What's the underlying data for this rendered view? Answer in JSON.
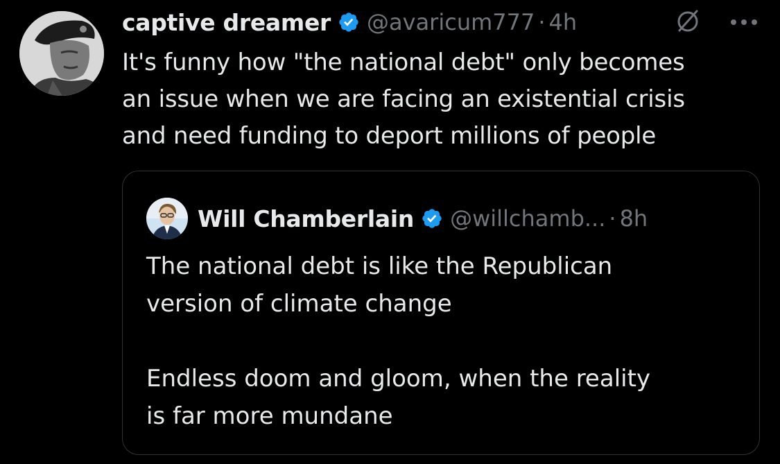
{
  "tweet": {
    "display_name": "captive dreamer",
    "handle": "@avaricum777",
    "separator": "·",
    "time": "4h",
    "verified": true,
    "avatar": "profile-photo",
    "text_lines": [
      "It's funny how \"the national debt\" only becomes",
      "an issue when we are facing an existential crisis",
      "and need funding to deport millions of people"
    ],
    "icons": [
      "grok-icon",
      "more-options-icon"
    ]
  },
  "quoted_tweet": {
    "display_name": "Will Chamberlain",
    "handle": "@willchamb...",
    "separator": "·",
    "time": "8h",
    "verified": true,
    "avatar": "profile-photo",
    "paragraphs": [
      [
        "The national debt is like the Republican",
        "version of climate change"
      ],
      [
        "Endless doom and gloom, when the reality",
        "is far more mundane"
      ]
    ]
  },
  "colors": {
    "background": "#000000",
    "text_primary": "#e7e9ea",
    "text_secondary": "#71767b",
    "verified_badge": "#1d9bf0",
    "border": "#2f3336"
  }
}
